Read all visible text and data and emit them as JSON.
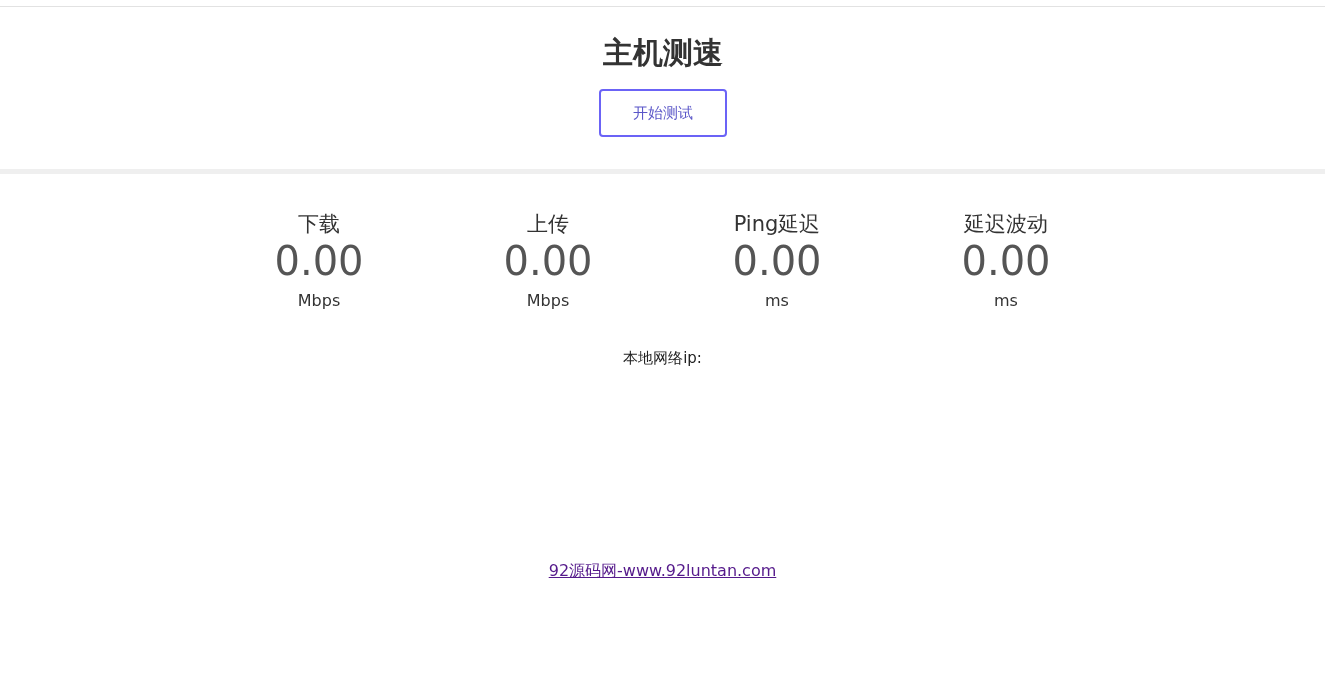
{
  "title": "主机测速",
  "start_button": "开始测试",
  "metrics": [
    {
      "label": "下载",
      "value": "0.00",
      "unit": "Mbps"
    },
    {
      "label": "上传",
      "value": "0.00",
      "unit": "Mbps"
    },
    {
      "label": "Ping延迟",
      "value": "0.00",
      "unit": "ms"
    },
    {
      "label": "延迟波动",
      "value": "0.00",
      "unit": "ms"
    }
  ],
  "local_ip_label": "本地网络ip:",
  "footer_link": "92源码网-www.92luntan.com"
}
